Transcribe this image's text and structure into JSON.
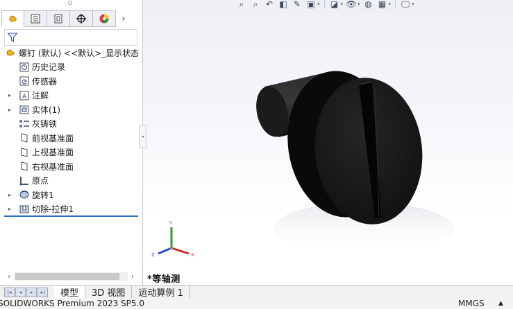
{
  "feature_tree": {
    "root_label": "螺钉 (默认) <<默认>_显示状态",
    "items": [
      {
        "label": "历史记录",
        "icon": "history-icon",
        "expandable": false
      },
      {
        "label": "传感器",
        "icon": "sensor-icon",
        "expandable": false
      },
      {
        "label": "注解",
        "icon": "annotation-icon",
        "expandable": true
      },
      {
        "label": "实体(1)",
        "icon": "solid-bodies-icon",
        "expandable": true
      },
      {
        "label": "灰铸铁",
        "icon": "material-icon",
        "expandable": false
      },
      {
        "label": "前视基准面",
        "icon": "plane-icon",
        "expandable": false
      },
      {
        "label": "上视基准面",
        "icon": "plane-icon",
        "expandable": false
      },
      {
        "label": "右视基准面",
        "icon": "plane-icon",
        "expandable": false
      },
      {
        "label": "原点",
        "icon": "origin-icon",
        "expandable": false
      },
      {
        "label": "旋转1",
        "icon": "revolve-icon",
        "expandable": true
      },
      {
        "label": "切除-拉伸1",
        "icon": "cut-extrude-icon",
        "expandable": true
      }
    ]
  },
  "panel_tabs": [
    "feature-manager-tab",
    "property-manager-tab",
    "configuration-manager-tab",
    "dimxpert-manager-tab",
    "display-manager-tab"
  ],
  "viewport": {
    "view_orientation": "*等轴测",
    "triad": {
      "x": "X",
      "y": "Y",
      "z": "Z"
    }
  },
  "bottom_tabs": [
    "模型",
    "3D 视图",
    "运动算例 1"
  ],
  "status": {
    "product": "SOLIDWORKS Premium 2023 SP5.0",
    "units": "MMGS",
    "units_caret": "▲"
  },
  "colors": {
    "selection_accent": "#2f6fc4",
    "model_body": "#151515",
    "triad_x": "#d22b2b",
    "triad_y": "#2e9e2e",
    "triad_z": "#2b4fd2"
  }
}
